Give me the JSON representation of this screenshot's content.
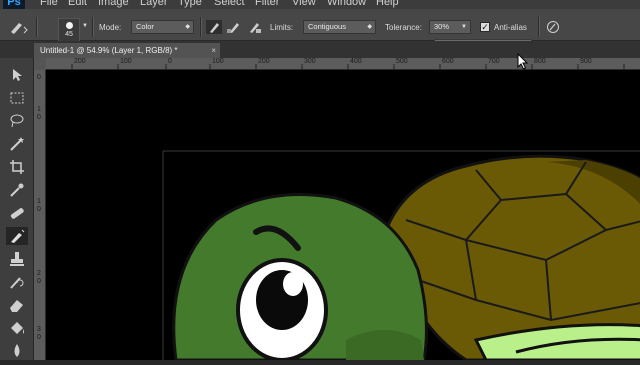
{
  "app": {
    "logo": "Ps"
  },
  "menu": [
    "File",
    "Edit",
    "Image",
    "Layer",
    "Type",
    "Select",
    "Filter",
    "View",
    "Window",
    "Help"
  ],
  "options": {
    "brush_size": "45",
    "mode_label": "Mode:",
    "mode_value": "Color",
    "limits_label": "Limits:",
    "limits_value": "Contiguous",
    "tolerance_label": "Tolerance:",
    "tolerance_value": "30%",
    "antialias_label": "Anti-alias",
    "antialias_checked": true
  },
  "tolerance_slider": {
    "value_percent": 30
  },
  "document_tab": {
    "title": "Untitled-1 @ 54.9% (Layer 1, RGB/8) *",
    "close": "×"
  },
  "ruler_top": [
    "200",
    "100",
    "0",
    "100",
    "200",
    "300",
    "400",
    "500",
    "600",
    "700",
    "800",
    "900"
  ],
  "ruler_left": [
    "0",
    "1",
    "0",
    "1",
    "0",
    "2",
    "0",
    "3",
    "0"
  ],
  "colors": {
    "turtle_head": "#447a2c",
    "turtle_shell": "#6b5a05",
    "turtle_shell_dark": "#4c3f02",
    "outline": "#111111",
    "belly_light": "#b9f08a"
  }
}
